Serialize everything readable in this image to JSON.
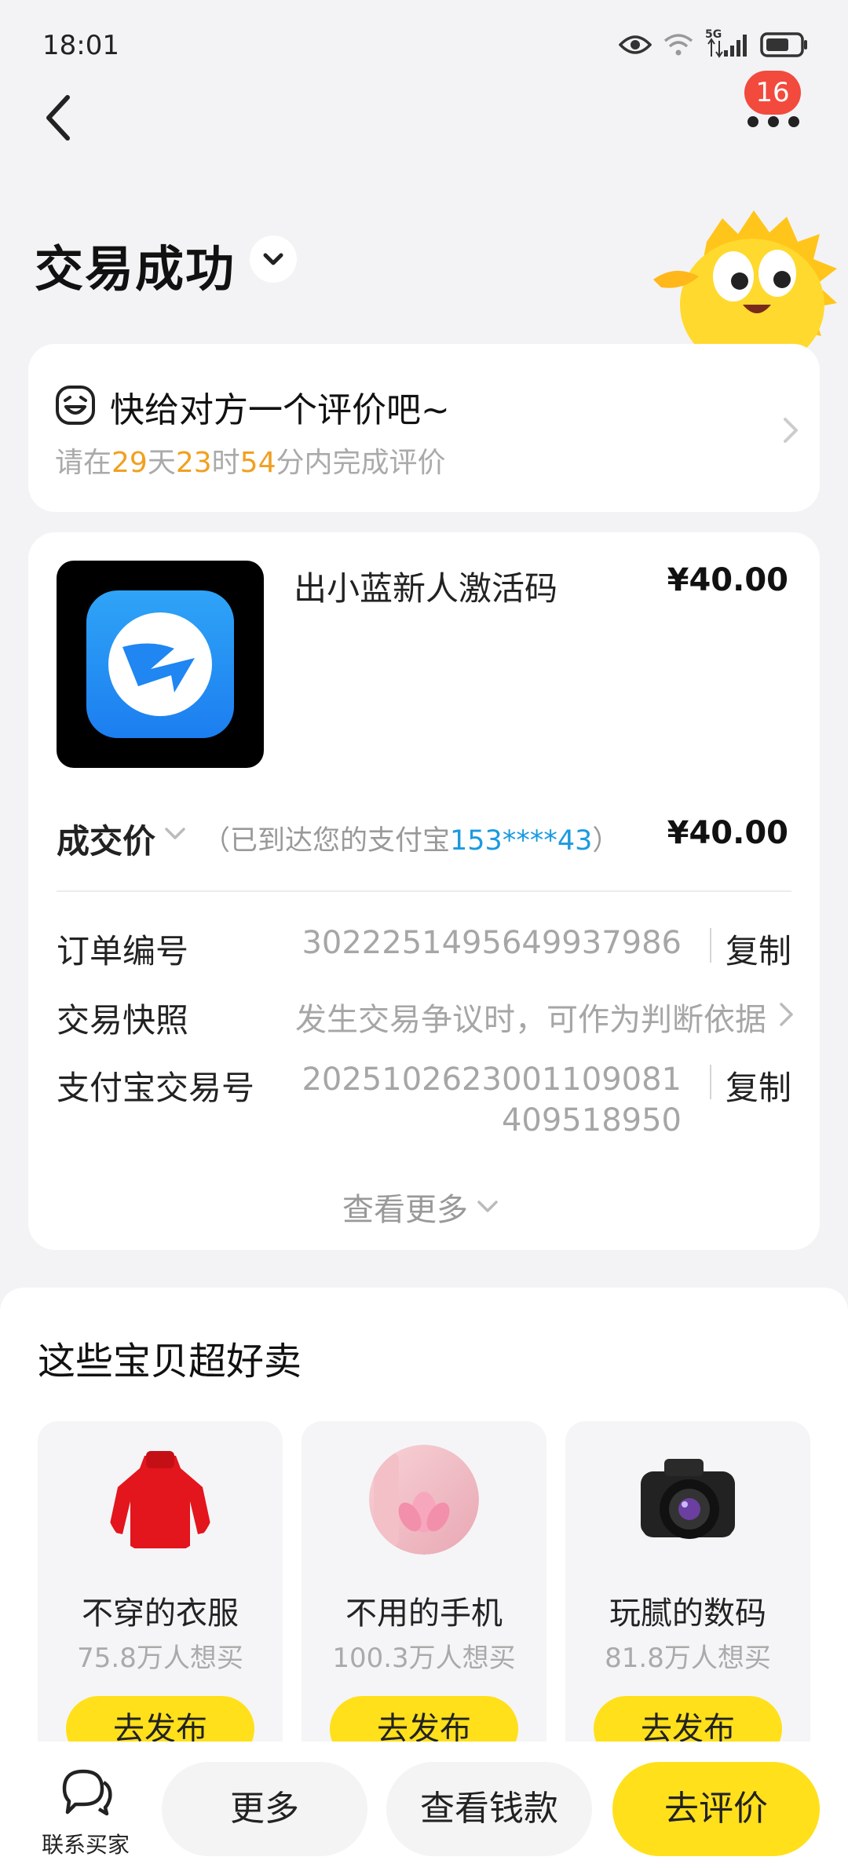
{
  "status_bar": {
    "time": "18:01",
    "network": "5G",
    "icons": [
      "eye-icon",
      "wifi-icon",
      "signal-icon",
      "battery-icon"
    ]
  },
  "nav": {
    "badge_count": "16"
  },
  "title": "交易成功",
  "review_prompt": {
    "title": "快给对方一个评价吧~",
    "prefix": "请在",
    "days": "29",
    "days_unit": "天",
    "hours": "23",
    "hours_unit": "时",
    "minutes": "54",
    "suffix": "分内完成评价"
  },
  "product": {
    "name": "出小蓝新人激活码",
    "price": "¥40.00"
  },
  "deal": {
    "label": "成交价",
    "note_prefix": "（已到达您的支付宝",
    "account": "153****43",
    "note_suffix": "）",
    "price": "¥40.00"
  },
  "order_rows": {
    "order_no_label": "订单编号",
    "order_no": "3022251495649937986",
    "copy": "复制",
    "snapshot_label": "交易快照",
    "snapshot_value": "发生交易争议时，可作为判断依据",
    "alipay_label": "支付宝交易号",
    "alipay_line1": "202510262300110908​1",
    "alipay_line2": "409518950"
  },
  "see_more": "查看更多",
  "recommend": {
    "title": "这些宝贝超好卖",
    "items": [
      {
        "name": "不穿的衣服",
        "count": "75.8万人想买",
        "button": "去发布"
      },
      {
        "name": "不用的手机",
        "count": "100.3万人想买",
        "button": "去发布"
      },
      {
        "name": "玩腻的数码",
        "count": "81.8万人想买",
        "button": "去发布"
      }
    ]
  },
  "bottom_bar": {
    "contact": "联系买家",
    "more": "更多",
    "view_money": "查看钱款",
    "review": "去评价"
  },
  "colors": {
    "accent_yellow": "#ffe01b",
    "highlight_orange": "#f0a020",
    "link_blue": "#1a9ae0",
    "badge_red": "#f24a3d"
  }
}
